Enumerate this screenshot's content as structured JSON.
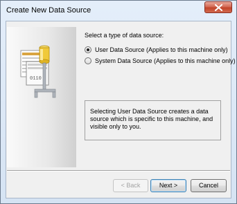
{
  "window": {
    "title": "Create New Data Source"
  },
  "main": {
    "prompt": "Select a type of data source:",
    "options": [
      {
        "label": "User Data Source (Applies to this machine only)",
        "selected": true
      },
      {
        "label": "System Data Source (Applies to this machine only)",
        "selected": false
      }
    ],
    "description": "Selecting User Data Source creates a data source which is specific to this machine, and visible only to you."
  },
  "buttons": {
    "back": "< Back",
    "next": "Next >",
    "cancel": "Cancel"
  },
  "illustration": {
    "label": "0110"
  },
  "colors": {
    "close_button": "#c7452b",
    "default_button_border": "#3c7fb1"
  }
}
